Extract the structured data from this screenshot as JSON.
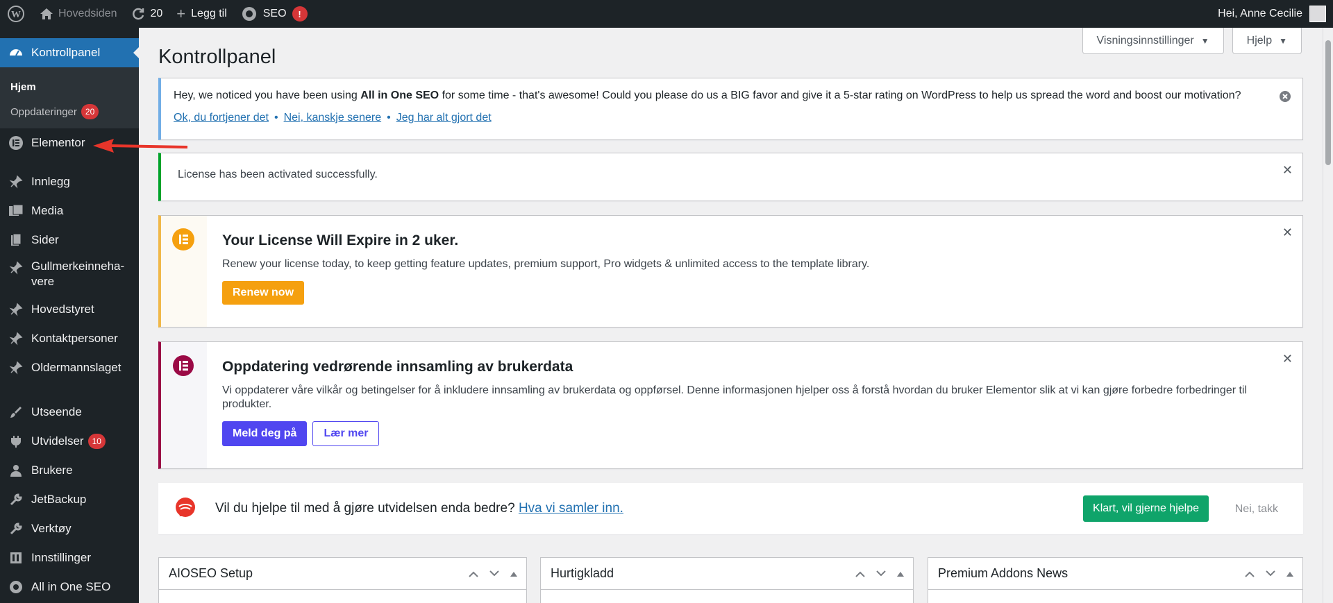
{
  "adminbar": {
    "site_name": "Hovedsiden",
    "updates_count": "20",
    "new_label": "Legg til",
    "seo_label": "SEO",
    "seo_badge": "!",
    "greeting": "Hei, Anne Cecilie"
  },
  "sidebar": {
    "dashboard": "Kontrollpanel",
    "sub_home": "Hjem",
    "sub_updates": "Oppdateringer",
    "sub_updates_badge": "20",
    "items": [
      {
        "label": "Elementor",
        "icon": "elementor-icon"
      },
      {
        "label": "Innlegg",
        "icon": "pin-icon"
      },
      {
        "label": "Media",
        "icon": "media-icon"
      },
      {
        "label": "Sider",
        "icon": "pages-icon"
      },
      {
        "label": "Gullmerkeinneha-vere",
        "icon": "pin-icon"
      },
      {
        "label": "Hovedstyret",
        "icon": "pin-icon"
      },
      {
        "label": "Kontaktpersoner",
        "icon": "pin-icon"
      },
      {
        "label": "Oldermannslaget",
        "icon": "pin-icon"
      },
      {
        "label": "Utseende",
        "icon": "brush-icon"
      },
      {
        "label": "Utvidelser",
        "icon": "plugin-icon",
        "badge": "10"
      },
      {
        "label": "Brukere",
        "icon": "users-icon"
      },
      {
        "label": "JetBackup",
        "icon": "wrench-icon"
      },
      {
        "label": "Verktøy",
        "icon": "tools-icon"
      },
      {
        "label": "Innstillinger",
        "icon": "settings-icon"
      },
      {
        "label": "All in One SEO",
        "icon": "aioseo-icon"
      }
    ]
  },
  "screen_meta": {
    "options": "Visningsinnstillinger",
    "help": "Hjelp"
  },
  "page_title": "Kontrollpanel",
  "notice_aioseo": {
    "text_before": "Hey, we noticed you have been using ",
    "text_bold": "All in One SEO",
    "text_after": " for some time - that's awesome! Could you please do us a BIG favor and give it a 5-star rating on WordPress to help us spread the word and boost our motivation?",
    "link1": "Ok, du fortjener det",
    "link2": "Nei, kanskje senere",
    "link3": "Jeg har alt gjort det",
    "dot": "•"
  },
  "notice_license": {
    "text": "License has been activated successfully.",
    "dismiss": "✕"
  },
  "notice_expire": {
    "title": "Your License Will Expire in 2 uker.",
    "text": "Renew your license today, to keep getting feature updates, premium support, Pro widgets & unlimited access to the template library.",
    "button": "Renew now",
    "dismiss": "✕"
  },
  "notice_update": {
    "title": "Oppdatering vedrørende innsamling av brukerdata",
    "text": "Vi oppdaterer våre vilkår og betingelser for å inkludere innsamling av brukerdata og oppførsel. Denne informasjonen hjelper oss å forstå hvordan du bruker Elementor slik at vi kan gjøre forbedre forbedringer til produkter.",
    "button_primary": "Meld deg på",
    "button_secondary": "Lær mer",
    "dismiss": "✕"
  },
  "notice_help": {
    "text": "Vil du hjelpe til med å gjøre utvidelsen enda bedre? ",
    "link": "Hva vi samler inn.",
    "accept": "Klart, vil gjerne hjelpe",
    "decline": "Nei, takk"
  },
  "postboxes": [
    {
      "title": "AIOSEO Setup"
    },
    {
      "title": "Hurtigkladd"
    },
    {
      "title": "Premium Addons News"
    }
  ],
  "colors": {
    "accent": "#2271b1",
    "admin_bg": "#1d2327",
    "badge": "#d63638",
    "renew": "#f5a00f",
    "primary_purple": "#5046f0",
    "green": "#0fa46a"
  }
}
